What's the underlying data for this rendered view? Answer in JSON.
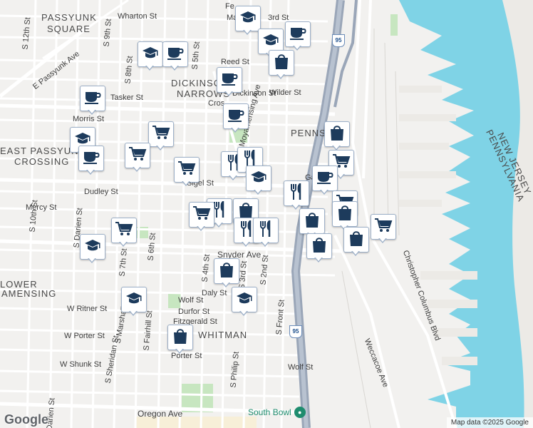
{
  "map": {
    "neighborhoods": [
      {
        "id": "passyunk-square-1",
        "text": "PASSYUNK"
      },
      {
        "id": "passyunk-square-2",
        "text": "SQUARE"
      },
      {
        "id": "dickinson-1",
        "text": "DICKINSON"
      },
      {
        "id": "dickinson-2",
        "text": "NARROWS"
      },
      {
        "id": "east-passyunk-1",
        "text": "EAST PASSYUNK"
      },
      {
        "id": "east-passyunk-2",
        "text": "CROSSING"
      },
      {
        "id": "penns",
        "text": "PENNS"
      },
      {
        "id": "lower-moyamensing-1",
        "text": "LOWER"
      },
      {
        "id": "lower-moyamensing-2",
        "text": "AMENSING"
      },
      {
        "id": "whitman",
        "text": "WHITMAN"
      },
      {
        "id": "new-jersey",
        "text": "NEW JERSEY"
      },
      {
        "id": "pennsylvania",
        "text": "PENNSYLVANIA"
      }
    ],
    "streets": [
      "Wharton St",
      "Reed St",
      "Dickinson St",
      "Tasker St",
      "Morris St",
      "Wilder St",
      "Cros",
      "Sigel St",
      "Dudley St",
      "Mercy St",
      "Snyder Ave",
      "Daly St",
      "Wolf St",
      "Durfor St",
      "Fitzgerald St",
      "W Ritner St",
      "W Porter St",
      "W Shunk St",
      "Oregon Ave",
      "Porter St",
      "E Passyunk Ave",
      "S 12th St",
      "S 10th St",
      "S 9th St",
      "S 8th St",
      "S 7th St",
      "S 6th St",
      "S 5th St",
      "S 4th St",
      "S 3rd St",
      "S 2nd St",
      "S Front St",
      "S Darien St",
      "S Marshall St",
      "S Sheridan St",
      "S Fairhill St",
      "S Philip St",
      "Christopher Columbus Blvd",
      "Weccacoe Ave",
      "Gaul St",
      "Fe",
      "Ma",
      "3rd St",
      "Moyamensing Ave",
      "Passyunk Ave",
      "Darien St",
      "S 7th St",
      "S Mar"
    ],
    "highway_shield": "95",
    "poi": {
      "name": "South Bowl",
      "icon": "bowling-icon"
    },
    "attribution": "Map data ©2025 Google",
    "logo": "Google"
  },
  "markers": [
    {
      "type": "school",
      "icon": "school-icon"
    },
    {
      "type": "school",
      "icon": "school-icon"
    },
    {
      "type": "cafe",
      "icon": "cafe-icon"
    },
    {
      "type": "shopping",
      "icon": "shopping-bag-icon"
    },
    {
      "type": "school",
      "icon": "school-icon"
    },
    {
      "type": "cafe",
      "icon": "cafe-icon"
    },
    {
      "type": "cafe",
      "icon": "cafe-icon"
    },
    {
      "type": "cafe",
      "icon": "cafe-icon"
    },
    {
      "type": "cafe",
      "icon": "cafe-icon"
    },
    {
      "type": "shopping",
      "icon": "shopping-bag-icon"
    },
    {
      "type": "grocery",
      "icon": "cart-icon"
    },
    {
      "type": "school",
      "icon": "school-icon"
    },
    {
      "type": "cafe",
      "icon": "cafe-icon"
    },
    {
      "type": "grocery",
      "icon": "cart-icon"
    },
    {
      "type": "restaurant",
      "icon": "restaurant-icon"
    },
    {
      "type": "restaurant",
      "icon": "restaurant-icon"
    },
    {
      "type": "grocery",
      "icon": "cart-icon"
    },
    {
      "type": "school",
      "icon": "school-icon"
    },
    {
      "type": "grocery",
      "icon": "cart-icon"
    },
    {
      "type": "cafe",
      "icon": "cafe-icon"
    },
    {
      "type": "restaurant",
      "icon": "restaurant-icon"
    },
    {
      "type": "grocery",
      "icon": "cart-icon"
    },
    {
      "type": "restaurant",
      "icon": "restaurant-icon"
    },
    {
      "type": "shopping",
      "icon": "shopping-bag-icon"
    },
    {
      "type": "shopping",
      "icon": "shopping-bag-icon"
    },
    {
      "type": "shopping",
      "icon": "shopping-bag-icon"
    },
    {
      "type": "grocery",
      "icon": "cart-icon"
    },
    {
      "type": "grocery",
      "icon": "cart-icon"
    },
    {
      "type": "restaurant",
      "icon": "restaurant-icon"
    },
    {
      "type": "restaurant",
      "icon": "restaurant-icon"
    },
    {
      "type": "grocery",
      "icon": "cart-icon"
    },
    {
      "type": "shopping",
      "icon": "shopping-bag-icon"
    },
    {
      "type": "shopping",
      "icon": "shopping-bag-icon"
    },
    {
      "type": "school",
      "icon": "school-icon"
    },
    {
      "type": "shopping",
      "icon": "shopping-bag-icon"
    },
    {
      "type": "school",
      "icon": "school-icon"
    },
    {
      "type": "school",
      "icon": "school-icon"
    },
    {
      "type": "shopping",
      "icon": "shopping-bag-icon"
    }
  ],
  "colors": {
    "water": "#7fd3e6",
    "land": "#f2f1ef",
    "road": "#ffffff",
    "highway": "#9aa6b8",
    "park": "#c7e6c0",
    "icon": "#1d3b5c",
    "pin_border": "#9db0c8"
  }
}
